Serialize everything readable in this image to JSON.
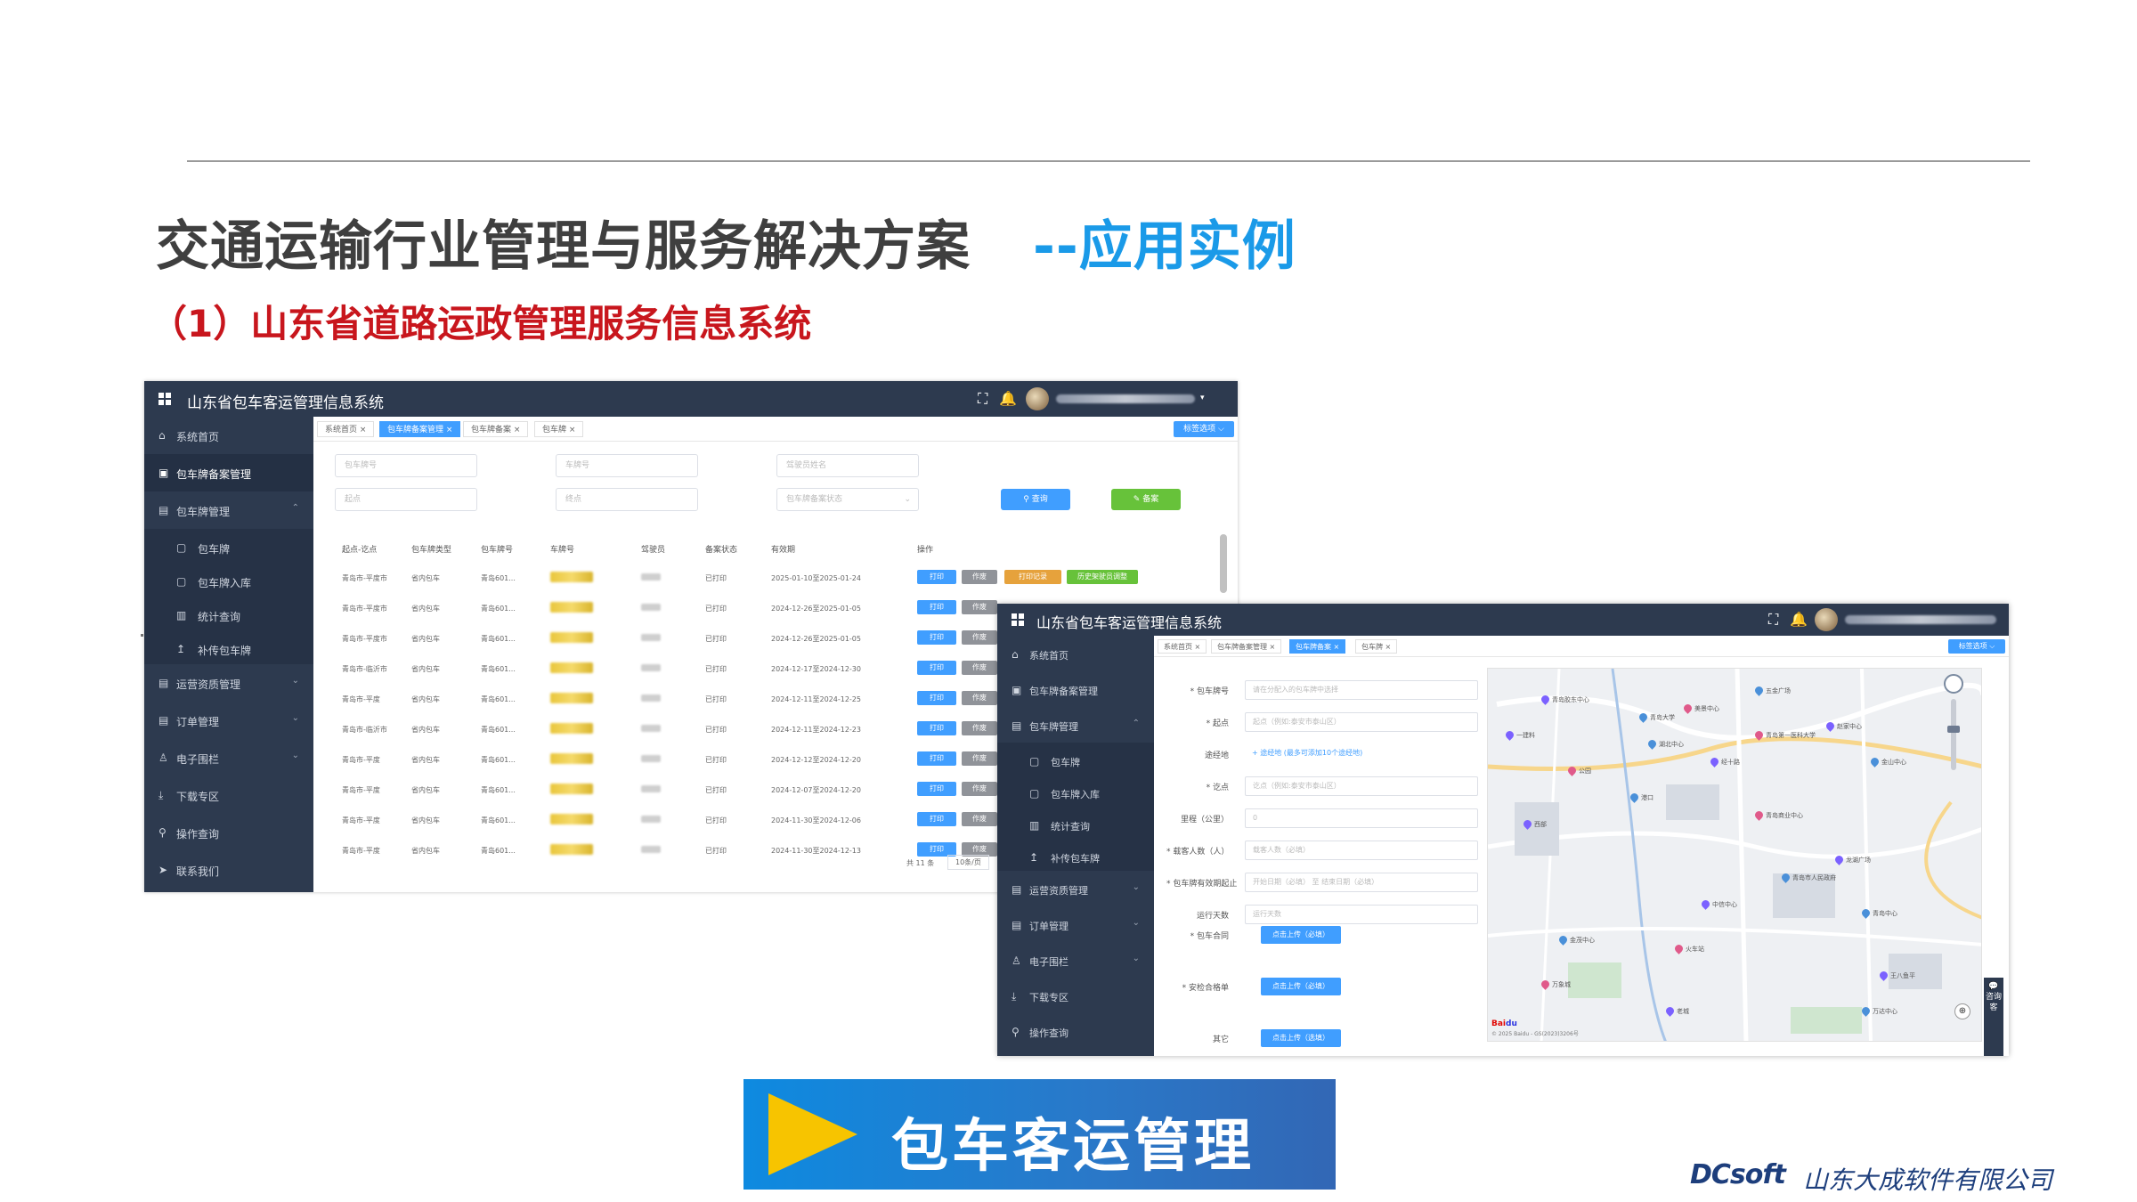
{
  "slide": {
    "title_main": "交通运输行业管理与服务解决方案",
    "title_accent": "--应用实例",
    "subtitle": "（1）山东省道路运政管理服务信息系统",
    "banner_text": "包车客运管理",
    "footer_brand": "DCsoft",
    "footer_company": "山东大成软件有限公司"
  },
  "app1": {
    "title": "山东省包车客运管理信息系统",
    "sidebar": [
      {
        "icon": "⌂",
        "label": "系统首页"
      },
      {
        "icon": "▣",
        "label": "包车牌备案管理"
      },
      {
        "icon": "▤",
        "label": "包车牌管理"
      },
      {
        "icon": "▢",
        "label": "包车牌"
      },
      {
        "icon": "▢",
        "label": "包车牌入库"
      },
      {
        "icon": "▥",
        "label": "统计查询"
      },
      {
        "icon": "↥",
        "label": "补传包车牌"
      },
      {
        "icon": "▤",
        "label": "运营资质管理"
      },
      {
        "icon": "▤",
        "label": "订单管理"
      },
      {
        "icon": "♙",
        "label": "电子围栏"
      },
      {
        "icon": "⤓",
        "label": "下载专区"
      },
      {
        "icon": "⚲",
        "label": "操作查询"
      },
      {
        "icon": "➤",
        "label": "联系我们"
      }
    ],
    "tabs": [
      "系统首页",
      "包车牌备案管理",
      "包车牌备案",
      "包车牌"
    ],
    "tab_dropdown": "标签选项 ⌵",
    "filters": {
      "plate_no": "包车牌号",
      "vehicle_no": "车牌号",
      "driver": "驾驶员姓名",
      "origin": "起点",
      "destination": "终点",
      "status": "包车牌备案状态"
    },
    "btn_search": "⚲ 查询",
    "btn_record": "✎ 备案",
    "columns": [
      "起点-讫点",
      "包车牌类型",
      "包车牌号",
      "车牌号",
      "驾驶员",
      "备案状态",
      "有效期",
      "操作"
    ],
    "rows": [
      {
        "route": "青岛市-平度市",
        "type": "省内包车",
        "plate": "青岛601...",
        "status": "已打印",
        "valid": "2025-01-10至2025-01-24"
      },
      {
        "route": "青岛市-平度市",
        "type": "省内包车",
        "plate": "青岛601...",
        "status": "已打印",
        "valid": "2024-12-26至2025-01-05"
      },
      {
        "route": "青岛市-平度市",
        "type": "省内包车",
        "plate": "青岛601...",
        "status": "已打印",
        "valid": "2024-12-26至2025-01-05"
      },
      {
        "route": "青岛市-临沂市",
        "type": "省内包车",
        "plate": "青岛601...",
        "status": "已打印",
        "valid": "2024-12-17至2024-12-30"
      },
      {
        "route": "青岛市-平度",
        "type": "省内包车",
        "plate": "青岛601...",
        "status": "已打印",
        "valid": "2024-12-11至2024-12-25"
      },
      {
        "route": "青岛市-临沂市",
        "type": "省内包车",
        "plate": "青岛601...",
        "status": "已打印",
        "valid": "2024-12-11至2024-12-23"
      },
      {
        "route": "青岛市-平度",
        "type": "省内包车",
        "plate": "青岛601...",
        "status": "已打印",
        "valid": "2024-12-12至2024-12-20"
      },
      {
        "route": "青岛市-平度",
        "type": "省内包车",
        "plate": "青岛601...",
        "status": "已打印",
        "valid": "2024-12-07至2024-12-20"
      },
      {
        "route": "青岛市-平度",
        "type": "省内包车",
        "plate": "青岛601...",
        "status": "已打印",
        "valid": "2024-11-30至2024-12-06"
      },
      {
        "route": "青岛市-平度",
        "type": "省内包车",
        "plate": "青岛601...",
        "status": "已打印",
        "valid": "2024-11-30至2024-12-13"
      }
    ],
    "action_print": "打印",
    "action_void": "作废",
    "action_print_record": "打印记录",
    "action_history": "历史架驶员调整",
    "pager_total": "共 11 条",
    "pager_size": "10条/页"
  },
  "app2": {
    "title": "山东省包车客运管理信息系统",
    "sidebar": [
      {
        "icon": "⌂",
        "label": "系统首页"
      },
      {
        "icon": "▣",
        "label": "包车牌备案管理"
      },
      {
        "icon": "▤",
        "label": "包车牌管理"
      },
      {
        "icon": "▢",
        "label": "包车牌"
      },
      {
        "icon": "▢",
        "label": "包车牌入库"
      },
      {
        "icon": "▥",
        "label": "统计查询"
      },
      {
        "icon": "↥",
        "label": "补传包车牌"
      },
      {
        "icon": "▤",
        "label": "运营资质管理"
      },
      {
        "icon": "▤",
        "label": "订单管理"
      },
      {
        "icon": "♙",
        "label": "电子围栏"
      },
      {
        "icon": "⤓",
        "label": "下载专区"
      },
      {
        "icon": "⚲",
        "label": "操作查询"
      }
    ],
    "tabs": [
      "系统首页",
      "包车牌备案管理",
      "包车牌备案",
      "包车牌"
    ],
    "tab_dropdown": "标签选项 ⌵",
    "form": [
      {
        "label": "* 包车牌号",
        "placeholder": "请在分配入的包车牌中选择"
      },
      {
        "label": "* 起点",
        "placeholder": "起点（例如:泰安市泰山区）"
      },
      {
        "label": "途经地",
        "placeholder": "+ 途经地 (最多可添加10个途经地)"
      },
      {
        "label": "* 讫点",
        "placeholder": "讫点（例如:泰安市泰山区）"
      },
      {
        "label": "里程（公里）",
        "placeholder": "0"
      },
      {
        "label": "* 载客人数（人）",
        "placeholder": "载客人数（必填）"
      },
      {
        "label": "* 包车牌有效期起止",
        "placeholder": "开始日期（必填）  至  结束日期（必填）"
      },
      {
        "label": "运行天数",
        "placeholder": "运行天数"
      }
    ],
    "upload_contract_label": "* 包车合同",
    "upload_contract_btn": "点击上传（必填）",
    "upload_check_label": "* 安检合格单",
    "upload_check_btn": "点击上传（必填）",
    "upload_other_label": "其它",
    "upload_other_btn": "点击上传（选填）",
    "consult": "咨询客",
    "map_labels": [
      "青岛胶东中心",
      "青岛大学",
      "美景中心",
      "五金广场",
      "一建料",
      "青岛第一医科大学",
      "湖北中心",
      "经十路",
      "赵家中心",
      "金山中心",
      "公园",
      "港口",
      "西部",
      "青岛商业中心",
      "青岛市人民政府",
      "中信中心",
      "龙湖广场",
      "青岛中心",
      "火车站",
      "金茂中心",
      "王八鱼平",
      "万象城",
      "万达中心",
      "老城"
    ]
  }
}
